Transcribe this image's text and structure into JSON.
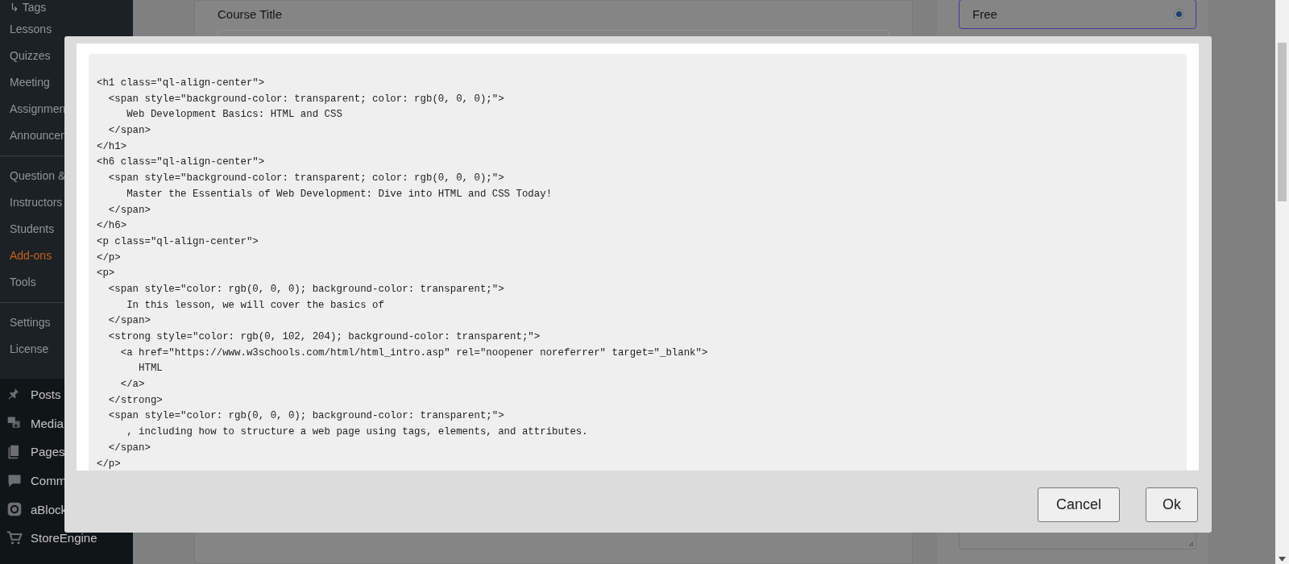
{
  "sidebar": {
    "submenu": [
      {
        "label": "↳ Tags",
        "selected": false
      },
      {
        "label": "Lessons",
        "selected": false
      },
      {
        "label": "Quizzes",
        "selected": false
      },
      {
        "label": "Meeting",
        "selected": false
      },
      {
        "label": "Assignmen",
        "selected": false
      },
      {
        "label": "Announcen",
        "selected": false,
        "divider_after": true
      },
      {
        "label": "Question &",
        "selected": false
      },
      {
        "label": "Instructors",
        "selected": false
      },
      {
        "label": "Students",
        "selected": false
      },
      {
        "label": "Add-ons",
        "selected": true
      },
      {
        "label": "Tools",
        "selected": false,
        "divider_after": true
      },
      {
        "label": "Settings",
        "selected": false
      },
      {
        "label": "License",
        "selected": false
      }
    ],
    "menu": [
      {
        "label": "Posts",
        "kind": "pin"
      },
      {
        "label": "Media",
        "kind": "media"
      },
      {
        "label": "Pages",
        "kind": "pages"
      },
      {
        "label": "Comm",
        "kind": "comments"
      },
      {
        "label": "aBlock",
        "kind": "block"
      },
      {
        "label": "StoreEngine",
        "kind": "cart"
      }
    ]
  },
  "course_title": {
    "label": "Course Title"
  },
  "pricing": {
    "option": {
      "label": "Free",
      "selected": true
    }
  },
  "modal": {
    "code_lines": [
      "<h1 class=\"ql-align-center\">",
      "  <span style=\"background-color: transparent; color: rgb(0, 0, 0);\">",
      "     Web Development Basics: HTML and CSS",
      "  </span>",
      "</h1>",
      "<h6 class=\"ql-align-center\">",
      "  <span style=\"background-color: transparent; color: rgb(0, 0, 0);\">",
      "     Master the Essentials of Web Development: Dive into HTML and CSS Today!",
      "  </span>",
      "</h6>",
      "<p class=\"ql-align-center\">",
      "</p>",
      "<p>",
      "  <span style=\"color: rgb(0, 0, 0); background-color: transparent;\">",
      "     In this lesson, we will cover the basics of",
      "  </span>",
      "  <strong style=\"color: rgb(0, 102, 204); background-color: transparent;\">",
      "    <a href=\"https://www.w3schools.com/html/html_intro.asp\" rel=\"noopener noreferrer\" target=\"_blank\">",
      "       HTML",
      "    </a>",
      "  </strong>",
      "  <span style=\"color: rgb(0, 0, 0); background-color: transparent;\">",
      "     , including how to structure a web page using tags, elements, and attributes.",
      "  </span>",
      "</p>"
    ],
    "buttons": [
      "Cancel",
      "Ok"
    ]
  }
}
